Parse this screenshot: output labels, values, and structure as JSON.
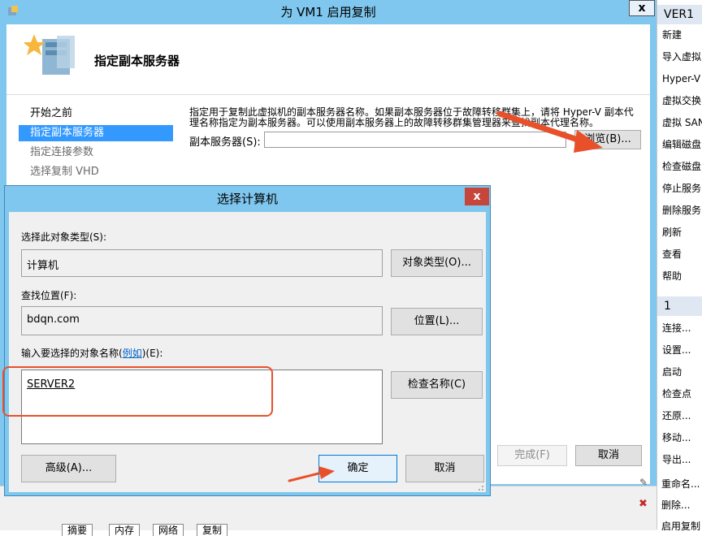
{
  "wizard": {
    "title": "为 VM1 启用复制",
    "close": "x",
    "header_title": "指定副本服务器",
    "nav": [
      {
        "label": "开始之前"
      },
      {
        "label": "指定副本服务器"
      },
      {
        "label": "指定连接参数"
      },
      {
        "label": "选择复制 VHD"
      }
    ],
    "description": "指定用于复制此虚拟机的副本服务器名称。如果副本服务器位于故障转移群集上，请将 Hyper-V 副本代理名称指定为副本服务器。可以使用副本服务器上的故障转移群集管理器来查找副本代理名称。",
    "replica_server_label": "副本服务器(S):",
    "replica_server_value": "",
    "browse_button": "浏览(B)...",
    "finish_button": "完成(F)",
    "cancel_button": "取消"
  },
  "dialog": {
    "title": "选择计算机",
    "close": "x",
    "object_type_label": "选择此对象类型(S):",
    "object_type_value": "计算机",
    "object_types_button": "对象类型(O)...",
    "location_label": "查找位置(F):",
    "location_value": "bdqn.com",
    "locations_button": "位置(L)...",
    "names_label_prefix": "输入要选择的对象名称(",
    "names_label_link": "例如",
    "names_label_suffix": ")(E):",
    "names_value": "SERVER2",
    "check_names_button": "检查名称(C)",
    "advanced_button": "高级(A)...",
    "ok_button": "确定",
    "cancel_button": "取消"
  },
  "actions_pane": {
    "header_vm": "VER1",
    "items_server": [
      "新建",
      "导入虚拟",
      "Hyper-V",
      "虚拟交换",
      "虚拟 SAN",
      "编辑磁盘",
      "检查磁盘",
      "停止服务",
      "删除服务",
      "刷新",
      "查看",
      "帮助"
    ],
    "header_vm2": "1",
    "items_vm": [
      "连接...",
      "设置...",
      "启动",
      "检查点",
      "还原...",
      "移动...",
      "导出...",
      "重命名...",
      "删除...",
      "启用复制"
    ]
  },
  "bottom_tabs": [
    "摘要",
    "内存",
    "网络",
    "复制"
  ],
  "colors": {
    "titlebar": "#7fc7ee",
    "selection": "#3399ff",
    "highlight_box": "#e8502a",
    "close_red": "#c7463c"
  }
}
